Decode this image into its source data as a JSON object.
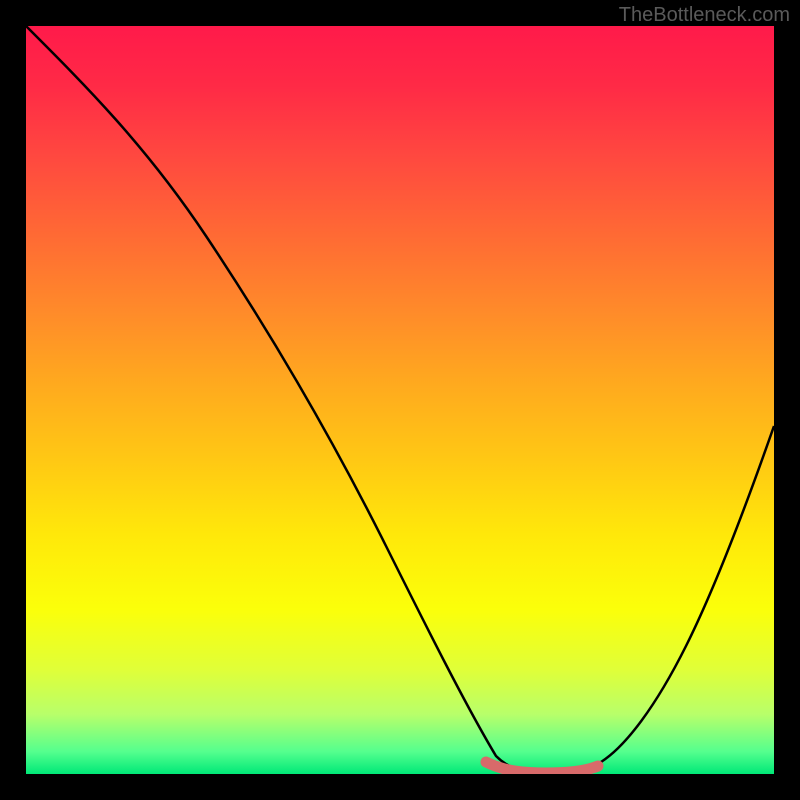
{
  "watermark": "TheBottleneck.com",
  "chart_data": {
    "type": "line",
    "title": "",
    "xlabel": "",
    "ylabel": "",
    "xlim": [
      0,
      100
    ],
    "ylim": [
      0,
      100
    ],
    "series": [
      {
        "name": "bottleneck-curve",
        "x": [
          0,
          8,
          16,
          24,
          32,
          40,
          48,
          56,
          60,
          64,
          68,
          72,
          76,
          80,
          88,
          100
        ],
        "values": [
          100,
          94,
          86,
          76,
          64,
          52,
          38,
          20,
          10,
          3,
          1,
          1,
          2,
          6,
          18,
          48
        ]
      }
    ],
    "annotations": [
      {
        "name": "optimal-range-highlight",
        "x_start": 60,
        "x_end": 75,
        "color": "#d86a6a"
      }
    ],
    "background_gradient": {
      "top": "#ff1a4a",
      "middle": "#ffe80a",
      "bottom": "#00e878"
    }
  }
}
